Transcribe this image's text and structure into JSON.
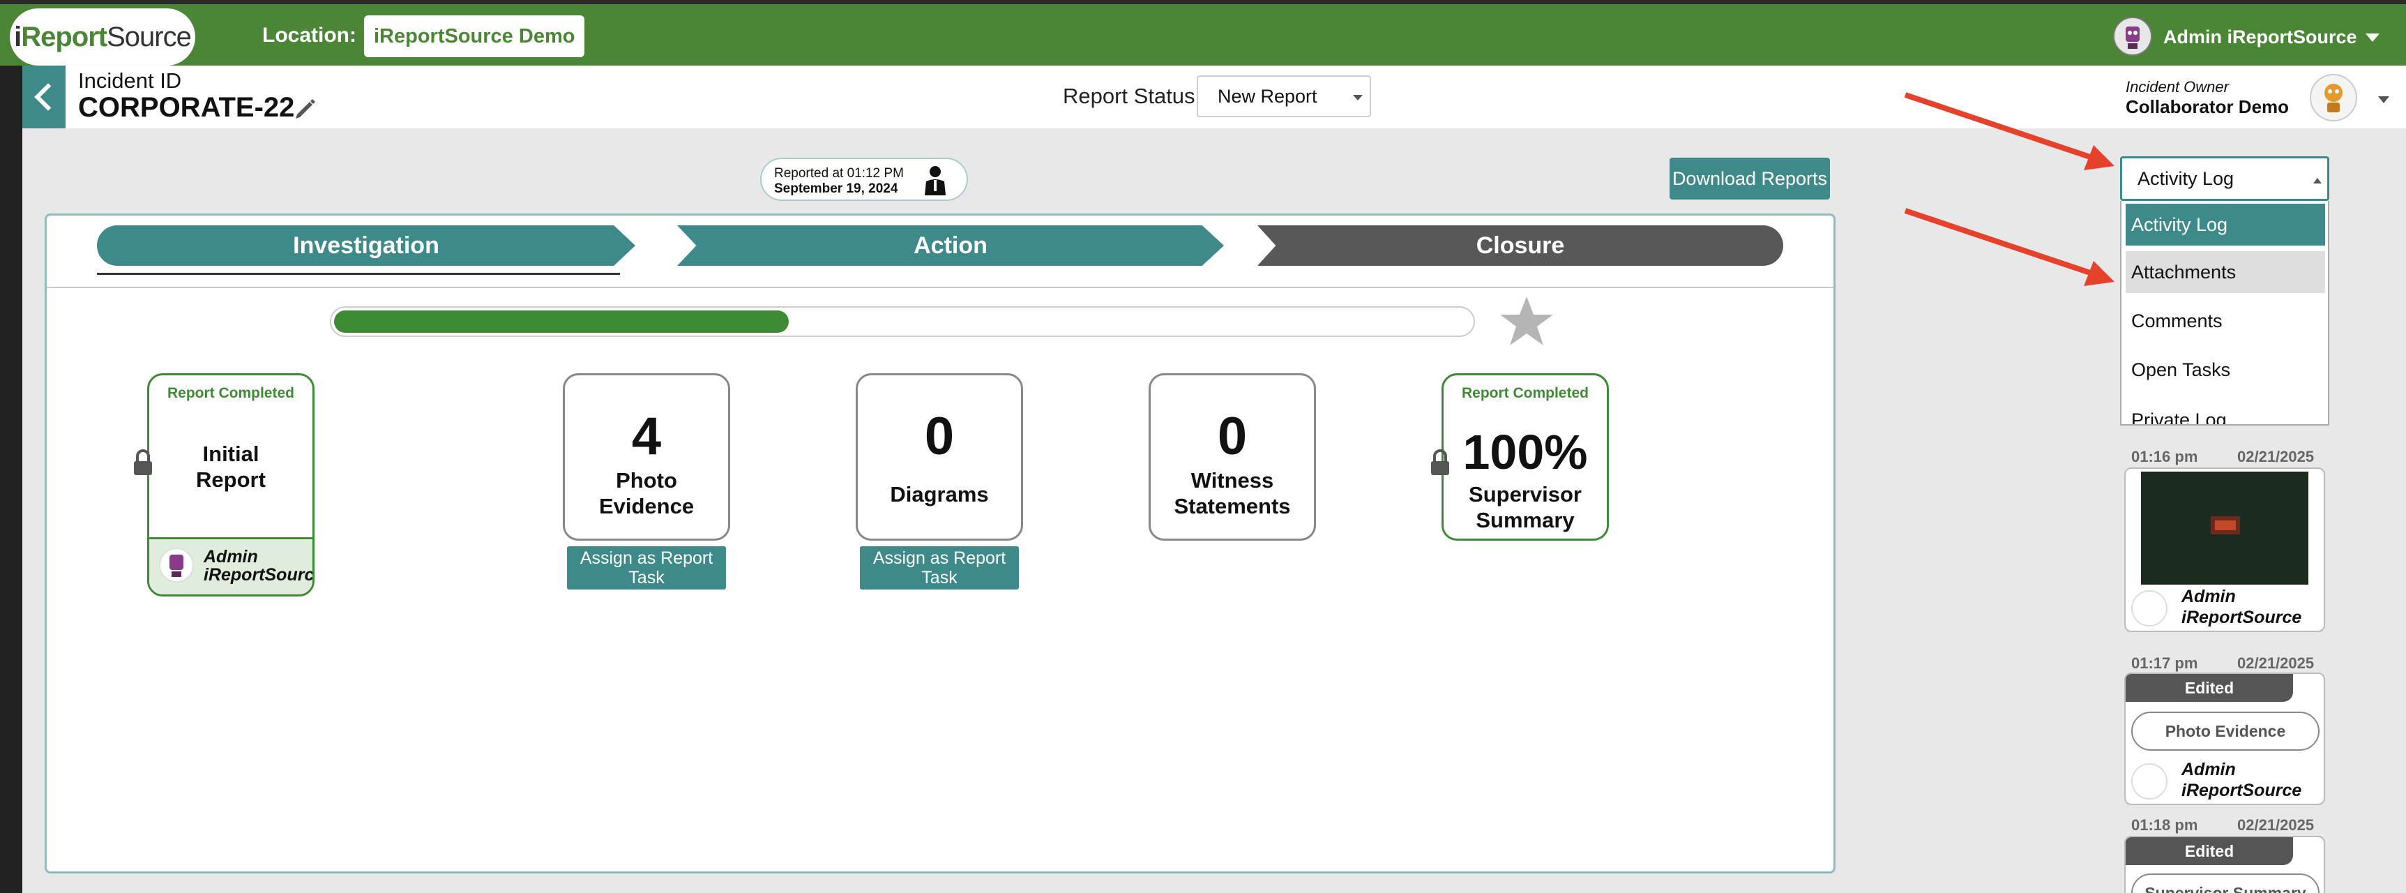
{
  "header": {
    "logo_text_i": "i",
    "logo_text_report": "Report",
    "logo_text_source": "Source",
    "location_label": "Location:",
    "location_value": "iReportSource Demo",
    "user_name": "Admin iReportSource"
  },
  "subheader": {
    "incident_label": "Incident ID",
    "incident_id": "CORPORATE-22",
    "status_label": "Report Status:",
    "status_value": "New Report",
    "owner_label": "Incident Owner",
    "owner_name": "Collaborator Demo"
  },
  "reported": {
    "time": "Reported at 01:12 PM",
    "date": "September 19, 2024"
  },
  "download_label": "Download Reports",
  "tabs": [
    {
      "label": "Investigation"
    },
    {
      "label": "Action"
    },
    {
      "label": "Closure"
    }
  ],
  "progress": {
    "fraction": 0.4
  },
  "cards": {
    "initial": {
      "done_label": "Report Completed",
      "title_line1": "Initial",
      "title_line2": "Report",
      "user_line1": "Admin",
      "user_line2": "iReportSource"
    },
    "photo": {
      "count": "4",
      "line1": "Photo",
      "line2": "Evidence",
      "assign": "Assign as Report Task"
    },
    "diagrams": {
      "count": "0",
      "line1": "Diagrams",
      "assign": "Assign as Report Task"
    },
    "witness": {
      "count": "0",
      "line1": "Witness",
      "line2": "Statements"
    },
    "supervisor": {
      "done_label": "Report Completed",
      "percent": "100%",
      "line1": "Supervisor",
      "line2": "Summary"
    }
  },
  "right_panel": {
    "selected": "Activity Log",
    "options": [
      "Activity Log",
      "Attachments",
      "Comments",
      "Open Tasks",
      "Private Log"
    ],
    "entries": [
      {
        "time": "01:16 pm",
        "date": "02/21/2025",
        "user_line1": "Admin",
        "user_line2": "iReportSource"
      },
      {
        "time": "01:17 pm",
        "date": "02/21/2025",
        "tag": "Edited",
        "item": "Photo Evidence",
        "user_line1": "Admin",
        "user_line2": "iReportSource"
      },
      {
        "time": "01:18 pm",
        "date": "02/21/2025",
        "tag": "Edited",
        "item": "Supervisor Summary"
      }
    ]
  },
  "colors": {
    "brand_green": "#4a8636",
    "teal": "#3e8a8a",
    "gray_tab": "#585858",
    "annotation_red": "#e5412b"
  }
}
